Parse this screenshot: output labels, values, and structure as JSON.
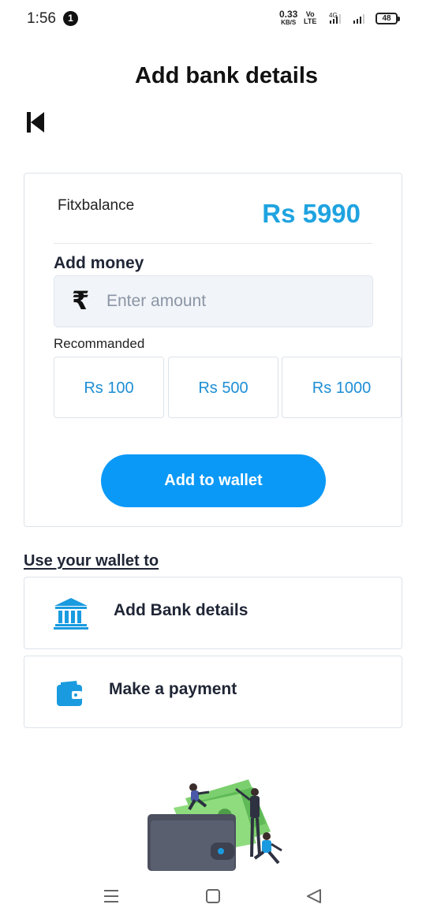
{
  "status_bar": {
    "time": "1:56",
    "notification_count": "1",
    "net_speed_value": "0.33",
    "net_speed_unit": "KB/S",
    "volte_top": "Vo",
    "volte_bottom": "LTE",
    "network_type": "4G",
    "battery": "48"
  },
  "header": {
    "title": "Add bank details",
    "back_icon": "skip-back-icon"
  },
  "wallet": {
    "balance_label": "Fitxbalance",
    "balance_value": "Rs 5990",
    "add_money_label": "Add money",
    "amount_placeholder": "Enter amount",
    "amount_value": "",
    "currency_icon": "rupee-icon",
    "recommended_label": "Recommanded",
    "recommended_amounts": [
      "Rs 100",
      "Rs 500",
      "Rs 1000"
    ],
    "add_button_label": "Add to wallet"
  },
  "use_wallet": {
    "heading": "Use your wallet to",
    "options": [
      {
        "label": "Add Bank details",
        "icon": "bank-icon"
      },
      {
        "label": "Make a payment",
        "icon": "wallet-icon"
      }
    ]
  },
  "navigation": {
    "buttons": [
      "menu-icon",
      "home-square-icon",
      "back-triangle-icon"
    ]
  },
  "colors": {
    "accent": "#0b99f7",
    "balance": "#1fa3e0",
    "chip_text": "#1e8ed4",
    "heading_text": "#1f2535"
  }
}
